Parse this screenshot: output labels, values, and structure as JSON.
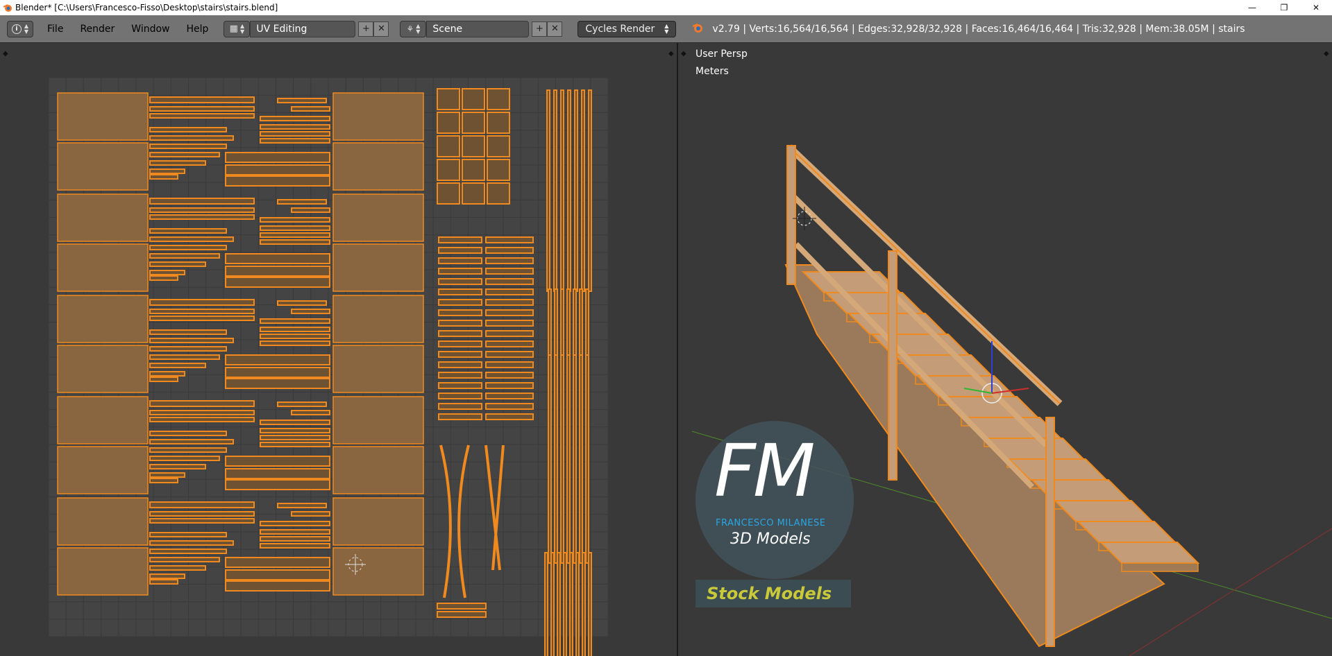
{
  "window": {
    "title": "Blender* [C:\\Users\\Francesco-Fisso\\Desktop\\stairs\\stairs.blend]",
    "minimize": "—",
    "maximize": "❐",
    "close": "✕"
  },
  "header": {
    "info_icon": "info-icon",
    "menus": [
      "File",
      "Render",
      "Window",
      "Help"
    ],
    "layout_name": "UV Editing",
    "scene_name": "Scene",
    "engine": "Cycles Render",
    "stats": "v2.79 | Verts:16,564/16,564 | Edges:32,928/32,928 | Faces:16,464/16,464 | Tris:32,928 | Mem:38.05M | stairs"
  },
  "viewport": {
    "view_name": "User Persp",
    "units": "Meters"
  },
  "watermark": {
    "logo": "FM",
    "brand": "FRANCESCO MILANESE",
    "subtitle": "3D Models",
    "banner": "Stock Models"
  },
  "colors": {
    "uv_orange": "#f08a1e",
    "face_fill": "#8a6640",
    "bg": "#393939",
    "grid_bg": "#444444",
    "accent_blue": "#1f9bd7",
    "banner_yellow": "#c9c93a"
  }
}
